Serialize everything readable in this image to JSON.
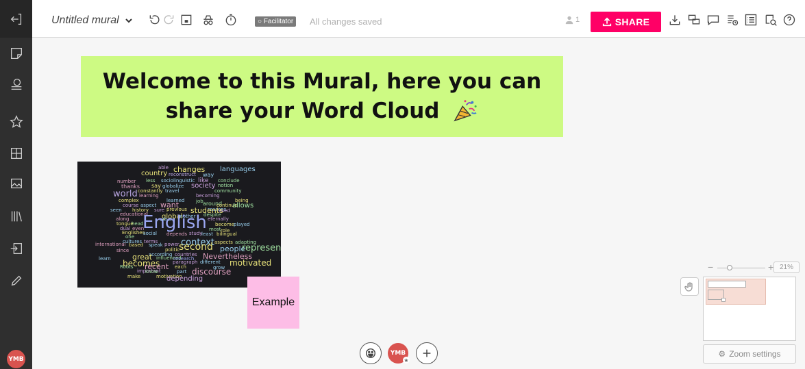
{
  "topbar": {
    "title": "Untitled mural",
    "facilitator_label": "Facilitator",
    "save_status": "All changes saved",
    "user_count": "1",
    "share_label": "SHARE"
  },
  "sidebar": {
    "avatar_initials": "YMB"
  },
  "canvas": {
    "banner_line1": "Welcome to this Mural, here you can",
    "banner_line2": "share your Word Cloud",
    "sticky_text": "Example",
    "banner_color": "#cdfa83",
    "sticky_color": "#fdbde6"
  },
  "wordcloud": [
    {
      "t": "able",
      "c": "#c9a0dc"
    },
    {
      "t": "changes",
      "c": "#e8e27a"
    },
    {
      "t": "languages",
      "c": "#9ad1f0"
    },
    {
      "t": "country",
      "c": "#e8e27a"
    },
    {
      "t": "reconstruct",
      "c": "#b8a5e0"
    },
    {
      "t": "way",
      "c": "#9ad1f0"
    },
    {
      "t": "number",
      "c": "#e0a0c0"
    },
    {
      "t": "less",
      "c": "#a0e0a0"
    },
    {
      "t": "sociolinguistic",
      "c": "#9ad1f0"
    },
    {
      "t": "like",
      "c": "#c9a0dc"
    },
    {
      "t": "conclude",
      "c": "#a0e0a0"
    },
    {
      "t": "thanks",
      "c": "#e0a0c0"
    },
    {
      "t": "say",
      "c": "#e8e27a"
    },
    {
      "t": "globalize",
      "c": "#9ad1f0"
    },
    {
      "t": "society",
      "c": "#c9a0dc"
    },
    {
      "t": "notion",
      "c": "#a0e0a0"
    },
    {
      "t": "world",
      "c": "#b8a5e0"
    },
    {
      "t": "constantly",
      "c": "#e8e27a"
    },
    {
      "t": "travel",
      "c": "#9ad1f0"
    },
    {
      "t": "community",
      "c": "#a0e0a0"
    },
    {
      "t": "learning",
      "c": "#e0a0c0"
    },
    {
      "t": "becoming",
      "c": "#c9a0dc"
    },
    {
      "t": "complex",
      "c": "#e8e27a"
    },
    {
      "t": "learned",
      "c": "#9ad1f0"
    },
    {
      "t": "job",
      "c": "#a0e0a0"
    },
    {
      "t": "being",
      "c": "#e8e27a"
    },
    {
      "t": "course",
      "c": "#c9a0dc"
    },
    {
      "t": "aspect",
      "c": "#9ad1f0"
    },
    {
      "t": "want",
      "c": "#e0a0c0"
    },
    {
      "t": "around",
      "c": "#a0e0a0"
    },
    {
      "t": "continue",
      "c": "#e8e27a"
    },
    {
      "t": "seen",
      "c": "#9ad1f0"
    },
    {
      "t": "history",
      "c": "#e8e27a"
    },
    {
      "t": "sure",
      "c": "#c9a0dc"
    },
    {
      "t": "previous",
      "c": "#e8e27a"
    },
    {
      "t": "reasons",
      "c": "#9ad1f0"
    },
    {
      "t": "allows",
      "c": "#a0e0a0"
    },
    {
      "t": "educational",
      "c": "#e0a0c0"
    },
    {
      "t": "students",
      "c": "#e8e27a"
    },
    {
      "t": "used",
      "c": "#c9a0dc"
    },
    {
      "t": "global",
      "c": "#e8e27a"
    },
    {
      "t": "mother",
      "c": "#9ad1f0"
    },
    {
      "t": "despite",
      "c": "#a0e0a0"
    },
    {
      "t": "along",
      "c": "#e0a0c0"
    },
    {
      "t": "other",
      "c": "#9ad1f0"
    },
    {
      "t": "eternally",
      "c": "#c9a0dc"
    },
    {
      "t": "tongue",
      "c": "#e8e27a"
    },
    {
      "t": "head",
      "c": "#a0e0a0"
    },
    {
      "t": "English",
      "c": "#9aa6f0"
    },
    {
      "t": "become",
      "c": "#e8e27a"
    },
    {
      "t": "played",
      "c": "#9ad1f0"
    },
    {
      "t": "dual",
      "c": "#c9a0dc"
    },
    {
      "t": "even",
      "c": "#e0a0c0"
    },
    {
      "t": "most",
      "c": "#a0e0a0"
    },
    {
      "t": "role",
      "c": "#e8e27a"
    },
    {
      "t": "Englishes",
      "c": "#e8e27a"
    },
    {
      "t": "social",
      "c": "#9ad1f0"
    },
    {
      "t": "study",
      "c": "#c9a0dc"
    },
    {
      "t": "least",
      "c": "#9ad1f0"
    },
    {
      "t": "bilingual",
      "c": "#e8e27a"
    },
    {
      "t": "one",
      "c": "#a0e0a0"
    },
    {
      "t": "depends",
      "c": "#e0a0c0"
    },
    {
      "t": "cultures",
      "c": "#9ad1f0"
    },
    {
      "t": "terms",
      "c": "#c9a0dc"
    },
    {
      "t": "context",
      "c": "#9ad1f0"
    },
    {
      "t": "aspects",
      "c": "#e8e27a"
    },
    {
      "t": "adapting",
      "c": "#a0e0a0"
    },
    {
      "t": "international",
      "c": "#e0a0c0"
    },
    {
      "t": "based",
      "c": "#e8e27a"
    },
    {
      "t": "speak",
      "c": "#9ad1f0"
    },
    {
      "t": "power",
      "c": "#c9a0dc"
    },
    {
      "t": "second",
      "c": "#e8e27a"
    },
    {
      "t": "people",
      "c": "#9ad1f0"
    },
    {
      "t": "represents",
      "c": "#a0e0a0"
    },
    {
      "t": "since",
      "c": "#e0a0c0"
    },
    {
      "t": "politic",
      "c": "#e8e27a"
    },
    {
      "t": "according",
      "c": "#9ad1f0"
    },
    {
      "t": "countries",
      "c": "#c9a0dc"
    },
    {
      "t": "Nevertheless",
      "c": "#e0a0c0"
    },
    {
      "t": "learn",
      "c": "#9ad1f0"
    },
    {
      "t": "great",
      "c": "#e8e27a"
    },
    {
      "t": "influenced",
      "c": "#a0e0a0"
    },
    {
      "t": "research",
      "c": "#9aa6f0"
    },
    {
      "t": "becomes",
      "c": "#e8e27a"
    },
    {
      "t": "paragraph",
      "c": "#c9a0dc"
    },
    {
      "t": "different",
      "c": "#9ad1f0"
    },
    {
      "t": "motivated",
      "c": "#e8e27a"
    },
    {
      "t": "Roots",
      "c": "#a0e0a0"
    },
    {
      "t": "recent",
      "c": "#e0a0c0"
    },
    {
      "t": "each",
      "c": "#e8e27a"
    },
    {
      "t": "grow",
      "c": "#9ad1f0"
    },
    {
      "t": "important",
      "c": "#c9a0dc"
    },
    {
      "t": "know",
      "c": "#a0e0a0"
    },
    {
      "t": "part",
      "c": "#9ad1f0"
    },
    {
      "t": "discourse",
      "c": "#e0a0c0"
    },
    {
      "t": "make",
      "c": "#e8e27a"
    },
    {
      "t": "motivation",
      "c": "#e8e27a"
    },
    {
      "t": "depending",
      "c": "#c9a0dc"
    }
  ],
  "zoom": {
    "minus": "−",
    "plus": "+",
    "value": "21%",
    "settings_label": "Zoom settings"
  },
  "bottom": {
    "avatar_initials": "YMB"
  },
  "colors": {
    "accent": "#ff0066",
    "sidebar_bg": "#2f2f2f",
    "avatar": "#d9534f"
  }
}
